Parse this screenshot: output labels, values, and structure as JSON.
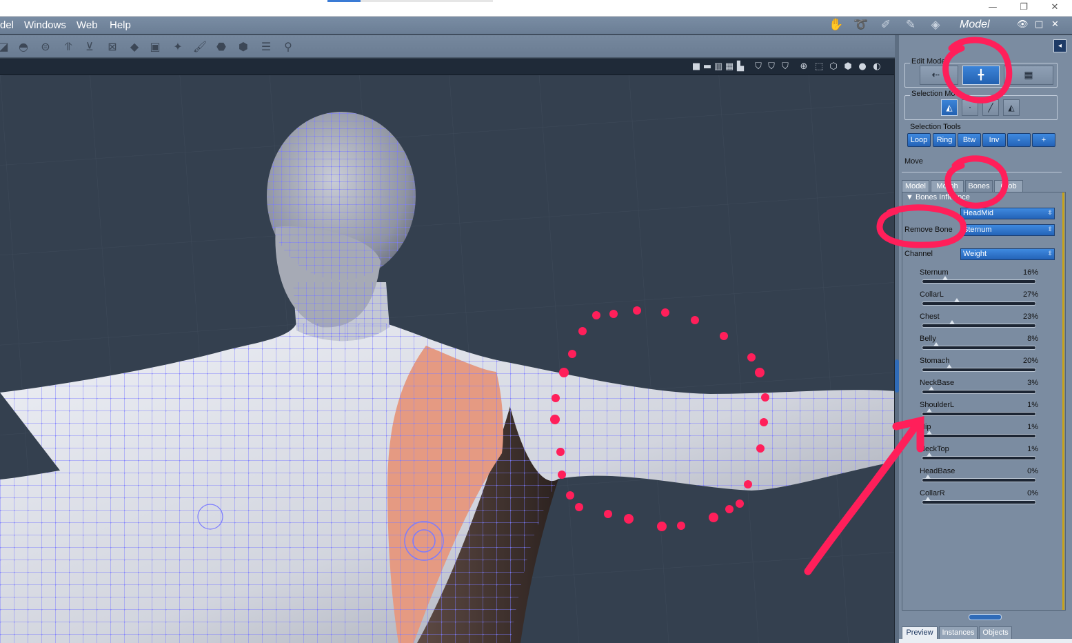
{
  "menubar": {
    "items": [
      "del",
      "Windows",
      "Web",
      "Help"
    ],
    "room_label": "Model"
  },
  "edit_mode": {
    "group_label": "Edit Mode",
    "active_mode": "Bones"
  },
  "selection_mode": {
    "group_label": "Selection Mo"
  },
  "selection_tools": {
    "label": "Selection Tools",
    "buttons": [
      "Loop",
      "Ring",
      "Btw",
      "Inv",
      "-",
      "+"
    ]
  },
  "move_label": "Move",
  "tabs": [
    "Model",
    "Morph",
    "Bones",
    "Glob"
  ],
  "active_tab": "Bones",
  "bones_influence": {
    "section_title": "Bones Influence",
    "bone_dropdown_value": "HeadMid",
    "remove_bone_label": "Remove Bone",
    "remove_bone_dropdown_value": "Sternum",
    "channel_label": "Channel",
    "channel_value": "Weight",
    "bones": [
      {
        "name": "Sternum",
        "value": "16%",
        "level": 0.16
      },
      {
        "name": "CollarL",
        "value": "27%",
        "level": 0.27
      },
      {
        "name": "Chest",
        "value": "23%",
        "level": 0.23
      },
      {
        "name": "Belly",
        "value": "8%",
        "level": 0.08
      },
      {
        "name": "Stomach",
        "value": "20%",
        "level": 0.2
      },
      {
        "name": "NeckBase",
        "value": "3%",
        "level": 0.03
      },
      {
        "name": "ShoulderL",
        "value": "1%",
        "level": 0.01
      },
      {
        "name": "Hip",
        "value": "1%",
        "level": 0.01
      },
      {
        "name": "NeckTop",
        "value": "1%",
        "level": 0.01
      },
      {
        "name": "HeadBase",
        "value": "0%",
        "level": 0.0
      },
      {
        "name": "CollarR",
        "value": "0%",
        "level": 0.0
      }
    ]
  },
  "bottom_tabs": [
    "Preview",
    "Instances",
    "Objects"
  ],
  "active_bottom_tab": "Preview",
  "colors": {
    "accent_blue": "#2f6bb8",
    "annotation_red": "#ff1f5a",
    "selection_fill": "#e59a82",
    "wireframe": "#7b7bff"
  }
}
